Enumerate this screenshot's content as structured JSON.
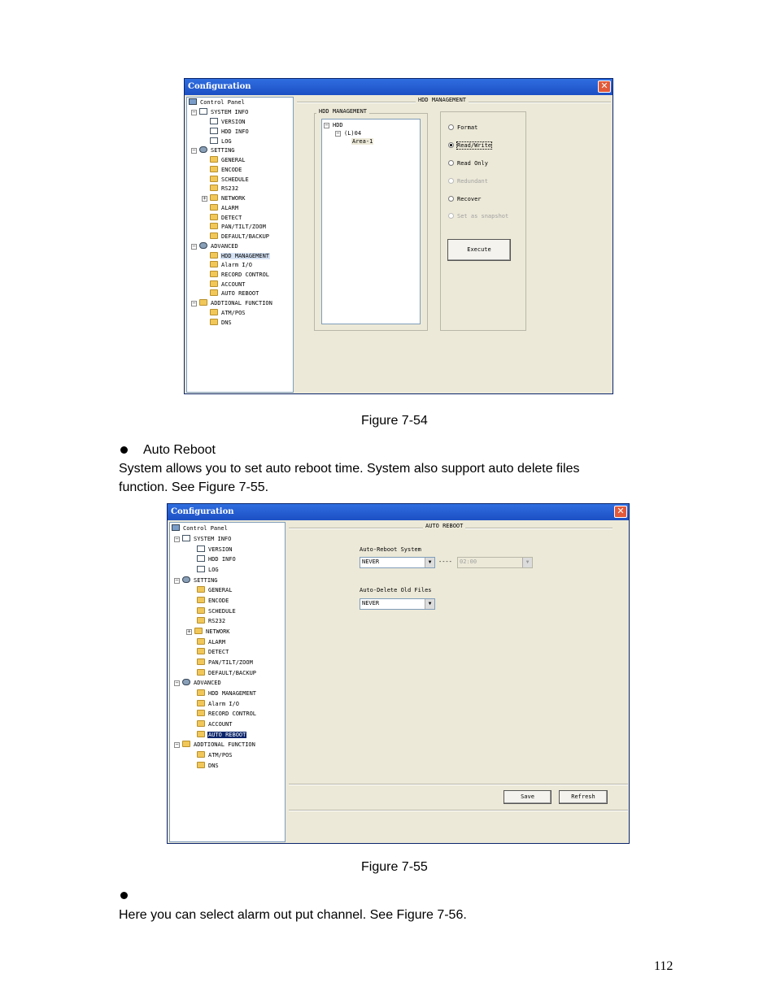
{
  "figure1": {
    "title": "Configuration",
    "close": "✕",
    "tree": [
      {
        "label": "Control Panel"
      },
      {
        "label": "SYSTEM INFO"
      },
      {
        "label": "VERSION"
      },
      {
        "label": "HDD INFO"
      },
      {
        "label": "LOG"
      },
      {
        "label": "SETTING"
      },
      {
        "label": "GENERAL"
      },
      {
        "label": "ENCODE"
      },
      {
        "label": "SCHEDULE"
      },
      {
        "label": "RS232"
      },
      {
        "label": "NETWORK"
      },
      {
        "label": "ALARM"
      },
      {
        "label": "DETECT"
      },
      {
        "label": "PAN/TILT/ZOOM"
      },
      {
        "label": "DEFAULT/BACKUP"
      },
      {
        "label": "ADVANCED"
      },
      {
        "label": "HDD MANAGEMENT"
      },
      {
        "label": "Alarm I/O"
      },
      {
        "label": "RECORD CONTROL"
      },
      {
        "label": "ACCOUNT"
      },
      {
        "label": "AUTO REBOOT"
      },
      {
        "label": "ADDTIONAL FUNCTION"
      },
      {
        "label": "ATM/POS"
      },
      {
        "label": "DNS"
      }
    ],
    "section_title": "HDD MANAGEMENT",
    "group_title": "HDD MANAGEMENT",
    "hdd_tree": [
      "HDD",
      "(L)04",
      "Area-1"
    ],
    "options": [
      {
        "label": "Format",
        "checked": false,
        "disabled": false
      },
      {
        "label": "Read/Write",
        "checked": true,
        "disabled": false
      },
      {
        "label": "Read Only",
        "checked": false,
        "disabled": false
      },
      {
        "label": "Redundant",
        "checked": false,
        "disabled": true
      },
      {
        "label": "Recover",
        "checked": false,
        "disabled": false
      },
      {
        "label": "Set as snapshot",
        "checked": false,
        "disabled": true
      }
    ],
    "execute_label": "Execute"
  },
  "caption1": "Figure 7-54",
  "section_heading": "Auto Reboot",
  "para1_line1": "System allows you to set auto reboot time. System also support auto delete files",
  "para1_line2": "function. See Figure 7-55.",
  "figure2": {
    "title": "Configuration",
    "close": "✕",
    "tree": [
      {
        "label": "Control Panel"
      },
      {
        "label": "SYSTEM INFO"
      },
      {
        "label": "VERSION"
      },
      {
        "label": "HDD INFO"
      },
      {
        "label": "LOG"
      },
      {
        "label": "SETTING"
      },
      {
        "label": "GENERAL"
      },
      {
        "label": "ENCODE"
      },
      {
        "label": "SCHEDULE"
      },
      {
        "label": "RS232"
      },
      {
        "label": "NETWORK"
      },
      {
        "label": "ALARM"
      },
      {
        "label": "DETECT"
      },
      {
        "label": "PAN/TILT/ZOOM"
      },
      {
        "label": "DEFAULT/BACKUP"
      },
      {
        "label": "ADVANCED"
      },
      {
        "label": "HDD MANAGEMENT"
      },
      {
        "label": "Alarm I/O"
      },
      {
        "label": "RECORD CONTROL"
      },
      {
        "label": "ACCOUNT"
      },
      {
        "label": "AUTO REBOOT"
      },
      {
        "label": "ADDTIONAL FUNCTION"
      },
      {
        "label": "ATM/POS"
      },
      {
        "label": "DNS"
      }
    ],
    "section_title": "AUTO REBOOT",
    "reboot_label": "Auto-Reboot System",
    "reboot_value": "NEVER",
    "reboot_sep": "----",
    "reboot_time": "02:00",
    "delete_label": "Auto-Delete Old Files",
    "delete_value": "NEVER",
    "dropdown_arrow": "▼",
    "save_label": "Save",
    "refresh_label": "Refresh"
  },
  "caption2": "Figure 7-55",
  "para2": "Here you can select alarm out put channel. See Figure 7-56.",
  "page_number": "112"
}
